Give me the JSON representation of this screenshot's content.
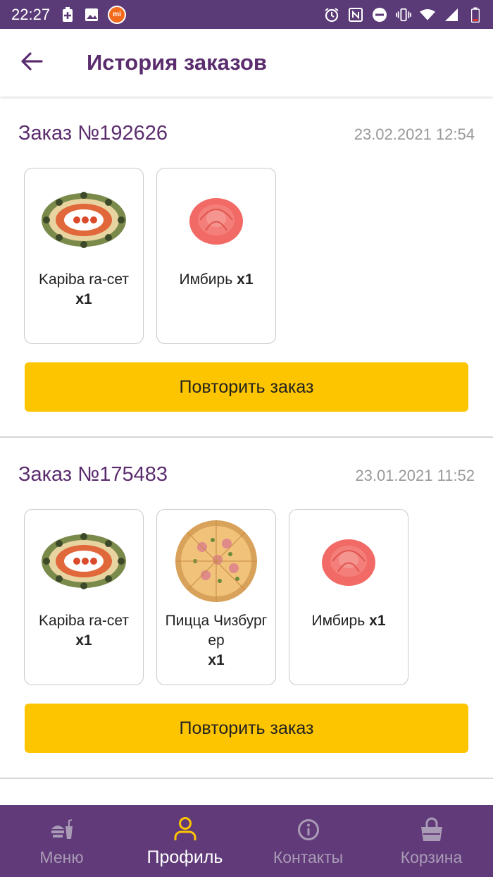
{
  "status_bar": {
    "time": "22:27",
    "left_icons": [
      "battery-saver-icon",
      "image-icon",
      "mi-icon"
    ],
    "mi_label": "mi",
    "right_icons": [
      "alarm-icon",
      "nfc-icon",
      "dnd-icon",
      "vibrate-icon",
      "wifi-icon",
      "signal-icon",
      "battery-icon"
    ]
  },
  "app_bar": {
    "title": "История заказов",
    "back_icon": "arrow-left-icon"
  },
  "orders": [
    {
      "number": "Заказ №192626",
      "date": "23.02.2021 12:54",
      "items": [
        {
          "name": "Kapiba ra-сет",
          "qty": "x1",
          "image": "sushi-set-image"
        },
        {
          "name": "Имбирь",
          "qty": "x1",
          "image": "ginger-image"
        }
      ],
      "repeat_label": "Повторить заказ"
    },
    {
      "number": "Заказ №175483",
      "date": "23.01.2021 11:52",
      "items": [
        {
          "name": "Kapiba ra-сет",
          "qty": "x1",
          "image": "sushi-set-image"
        },
        {
          "name": "Пицца Чизбургер",
          "qty": "x1",
          "image": "pizza-image"
        },
        {
          "name": "Имбирь",
          "qty": "x1",
          "image": "ginger-image"
        }
      ],
      "repeat_label": "Повторить заказ"
    }
  ],
  "bottom_nav": {
    "items": [
      {
        "label": "Меню",
        "icon": "food-menu-icon",
        "active": false
      },
      {
        "label": "Профиль",
        "icon": "person-icon",
        "active": true
      },
      {
        "label": "Контакты",
        "icon": "info-icon",
        "active": false
      },
      {
        "label": "Корзина",
        "icon": "shopping-bag-icon",
        "active": false
      }
    ]
  },
  "colors": {
    "primary": "#613a79",
    "title": "#5b2d6e",
    "accent_button": "#fdc500",
    "nav_active_icon": "#fdc500",
    "nav_inactive": "#a99bb6"
  }
}
